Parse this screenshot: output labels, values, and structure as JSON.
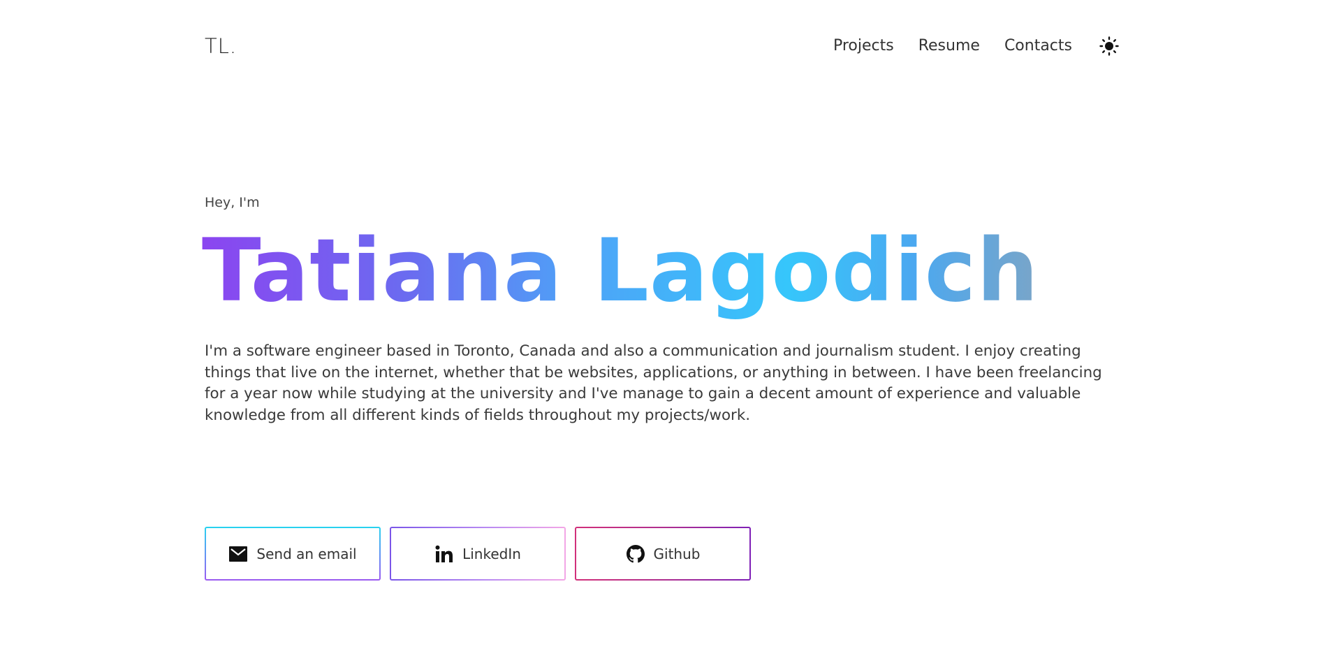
{
  "header": {
    "logo": "TL.",
    "nav": [
      {
        "label": "Projects"
      },
      {
        "label": "Resume"
      },
      {
        "label": "Contacts"
      }
    ],
    "theme_icon": "sun-icon"
  },
  "hero": {
    "greeting": "Hey, I'm",
    "name": "Tatiana Lagodich",
    "bio": "I'm a software engineer based in Toronto, Canada and also a communication and journalism student. I enjoy creating things that live on the internet, whether that be websites, applications, or anything in between. I have been freelancing for a year now while studying at the university and I've manage to gain a decent amount of experience and valuable knowledge from all different kinds of fields throughout my projects/work."
  },
  "buttons": [
    {
      "label": "Send an email",
      "icon": "mail-icon"
    },
    {
      "label": "LinkedIn",
      "icon": "linkedin-icon"
    },
    {
      "label": "Github",
      "icon": "github-icon"
    }
  ],
  "colors": {
    "name_gradient_start": "#8b45f0",
    "name_gradient_mid": "#36c6fb",
    "name_gradient_end": "#7aa5c8",
    "email_border": "#27d3ef",
    "linkedin_border": "#f3a6e6",
    "github_border": "#d1307a"
  }
}
